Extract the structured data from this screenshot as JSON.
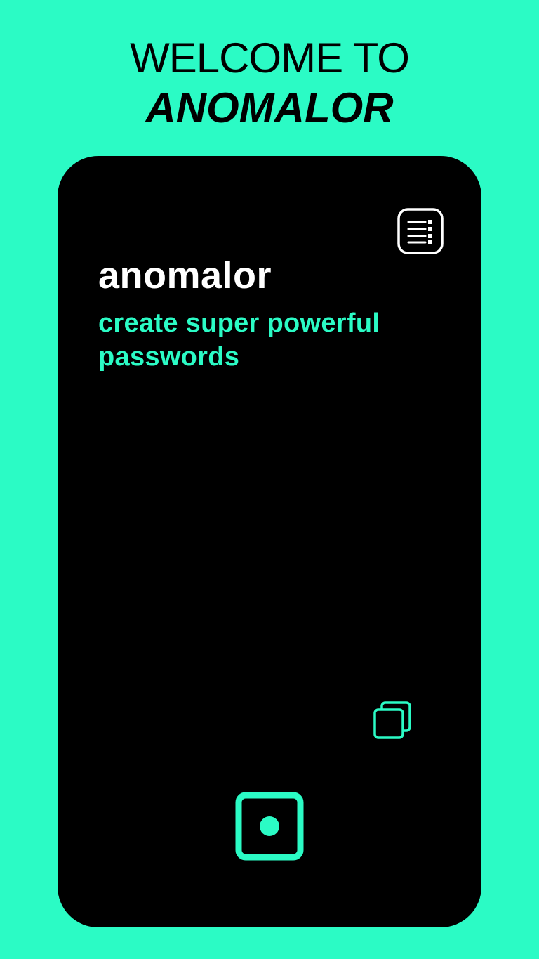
{
  "welcome": {
    "line1": "WELCOME TO",
    "line2": "ANOMALOR"
  },
  "app": {
    "name": "anomalor",
    "tagline": "create super powerful passwords"
  },
  "icons": {
    "menu": "list-menu-icon",
    "copy": "copy-icon",
    "generate": "dice-icon"
  },
  "colors": {
    "background": "#2bfbc5",
    "card": "#000000",
    "accent": "#2bfbc5",
    "title_text": "#ffffff",
    "headline_text": "#000000"
  }
}
